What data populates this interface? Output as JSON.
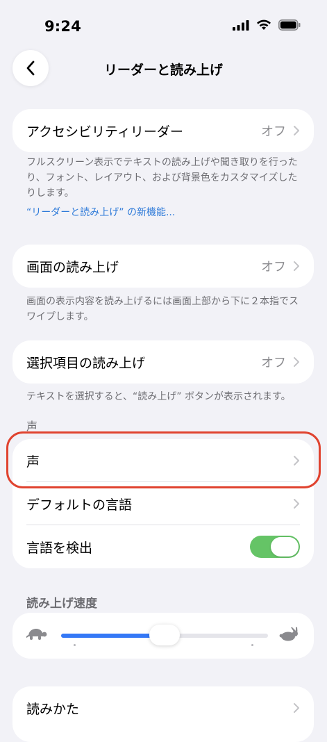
{
  "status_bar": {
    "time": "9:24",
    "icons": [
      "signal-icon",
      "wifi-icon",
      "battery-icon"
    ]
  },
  "nav": {
    "title": "リーダーと読み上げ",
    "back_icon": "chevron-left-icon"
  },
  "accessibility_reader": {
    "label": "アクセシビリティリーダー",
    "value": "オフ",
    "footnote": "フルスクリーン表示でテキストの読み上げや聞き取りを行ったり、フォント、レイアウト、および背景色をカスタマイズしたりします。",
    "link": "“リーダーと読み上げ” の新機能..."
  },
  "speak_screen": {
    "label": "画面の読み上げ",
    "value": "オフ",
    "footnote": "画面の表示内容を読み上げるには画面上部から下に２本指でスワイプします。"
  },
  "speak_selection": {
    "label": "選択項目の読み上げ",
    "value": "オフ",
    "footnote": "テキストを選択すると、“読み上げ” ボタンが表示されます。"
  },
  "voice_section": {
    "header": "声",
    "rows": {
      "voice": "声",
      "default_language": "デフォルトの言語",
      "detect_language": "言語を検出"
    },
    "detect_language_on": true
  },
  "speaking_rate": {
    "header": "読み上げ速度",
    "value": 0.5,
    "slow_icon": "turtle-icon",
    "fast_icon": "rabbit-icon"
  },
  "pronunciation": {
    "label": "読みかた"
  },
  "colors": {
    "accent": "#3478f6",
    "toggle_on": "#65c466",
    "link": "#2f7bd9",
    "highlight": "#e0432f"
  }
}
